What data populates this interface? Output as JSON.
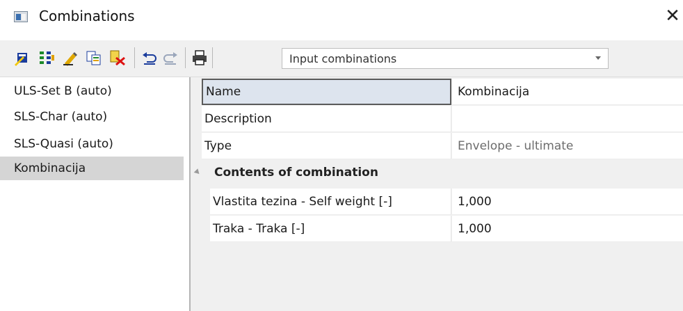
{
  "window": {
    "title": "Combinations"
  },
  "toolbar": {
    "icons": [
      "new-combination-icon",
      "generate-icon",
      "edit-icon",
      "copy-icon",
      "delete-icon",
      "undo-icon",
      "redo-icon",
      "print-icon"
    ],
    "dropdown_value": "Input combinations"
  },
  "sidebar": {
    "items": [
      {
        "label": "ULS-Set B (auto)"
      },
      {
        "label": "SLS-Char (auto)"
      },
      {
        "label": "SLS-Quasi (auto)"
      },
      {
        "label": "Kombinacija"
      }
    ],
    "selected_index": 3
  },
  "properties": {
    "rows": [
      {
        "name": "Name",
        "value": "Kombinacija"
      },
      {
        "name": "Description",
        "value": ""
      },
      {
        "name": "Type",
        "value": "Envelope - ultimate"
      }
    ],
    "group": {
      "label": "Contents of combination",
      "rows": [
        {
          "name": "Vlastita tezina - Self weight [-]",
          "value": "1,000"
        },
        {
          "name": "Traka - Traka [-]",
          "value": "1,000"
        }
      ]
    }
  },
  "colors": {
    "selection": "#d5d5d5",
    "grid_bg": "#f0f0f0"
  }
}
